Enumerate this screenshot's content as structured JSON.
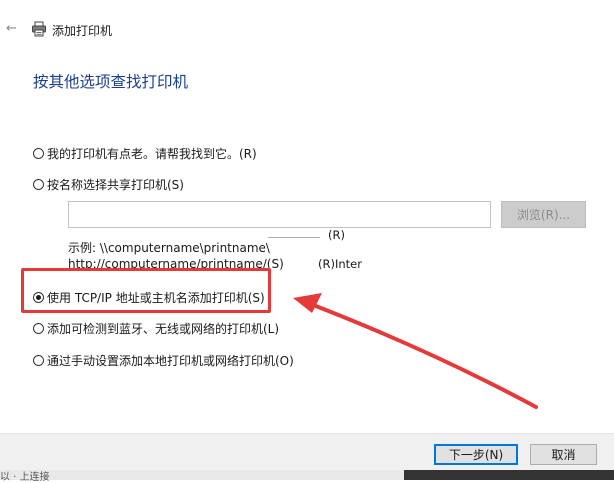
{
  "window": {
    "title": "添加打印机",
    "back_icon": "back-arrow-icon",
    "printer_icon": "printer-icon"
  },
  "heading": "按其他选项查找打印机",
  "options": [
    {
      "label": "我的打印机有点老。请帮我找到它。(R)",
      "checked": false
    },
    {
      "label": "按名称选择共享打印机(S)",
      "checked": false
    },
    {
      "label": "使用 TCP/IP 地址或主机名添加打印机(S)",
      "checked": true
    },
    {
      "label": "添加可检测到蓝牙、无线或网络的打印机(L)",
      "checked": false
    },
    {
      "label": "通过手动设置添加本地打印机或网络打印机(O)",
      "checked": false
    }
  ],
  "share_input": {
    "value": "",
    "browse_label": "浏览(R)..."
  },
  "examples": {
    "line1": "示例: \\\\computername\\printname\\",
    "line2": "http://computername/printname/(S)",
    "ghost_r1": "(R)",
    "ghost_s": "(S)",
    "ghost_r2": "(R)Inter"
  },
  "footer": {
    "next_label": "下一步(N)",
    "cancel_label": "取消",
    "bottom_left_text": "以 · 上连接"
  },
  "colors": {
    "heading": "#1b3f8f",
    "highlight": "#e5393a",
    "focus": "#0078d7"
  }
}
